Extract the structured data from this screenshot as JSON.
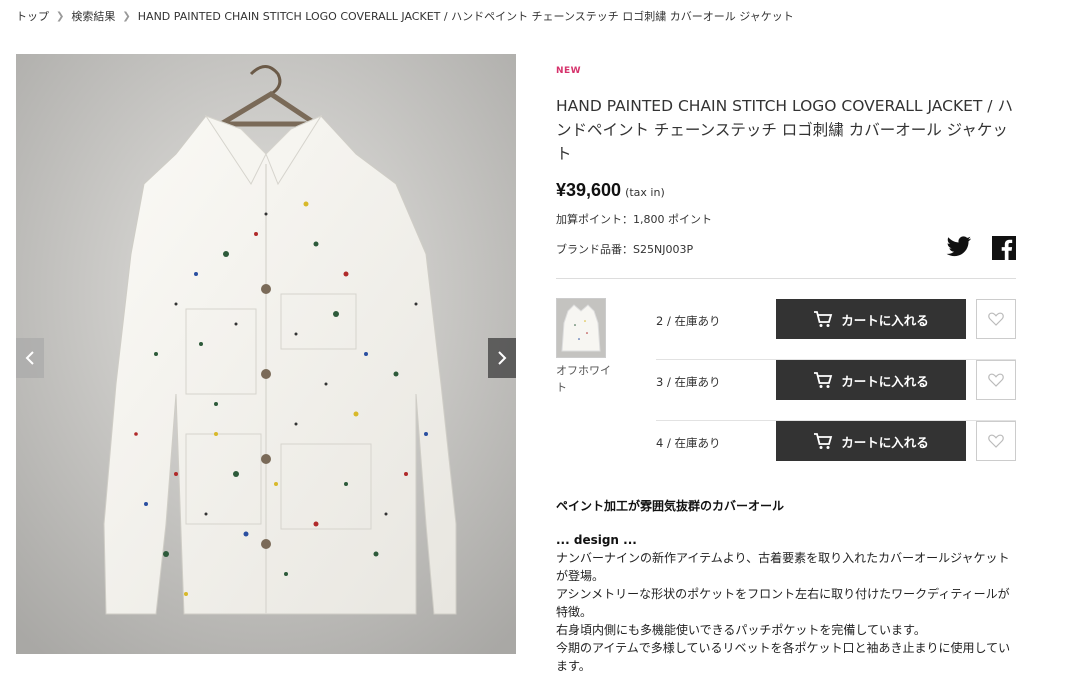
{
  "breadcrumb": {
    "items": [
      "トップ",
      "検索結果",
      "HAND PAINTED CHAIN STITCH LOGO COVERALL JACKET / ハンドペイント チェーンステッチ ロゴ刺繍 カバーオール ジャケット"
    ]
  },
  "product": {
    "badge": "NEW",
    "title": "HAND PAINTED CHAIN STITCH LOGO COVERALL JACKET / ハンドペイント チェーンステッチ ロゴ刺繍 カバーオール ジャケット",
    "price": "¥39,600",
    "tax_note": "(tax in)",
    "points": "加算ポイント：1,800 ポイント",
    "brand_code": "ブランド品番：S25NJ003P"
  },
  "share": {
    "twitter_icon": "twitter-icon",
    "facebook_icon": "facebook-icon"
  },
  "variant": {
    "color_name": "オフホワイト",
    "sizes": [
      {
        "label": "2 / 在庫あり",
        "cart_label": "カートに入れる"
      },
      {
        "label": "3 / 在庫あり",
        "cart_label": "カートに入れる"
      },
      {
        "label": "4 / 在庫あり",
        "cart_label": "カートに入れる"
      }
    ]
  },
  "description": {
    "heading": "ペイント加工が雰囲気抜群のカバーオール",
    "subheading": "... design ...",
    "paragraphs": [
      "ナンバーナインの新作アイテムより、古着要素を取り入れたカバーオールジャケットが登場。",
      "アシンメトリーな形状のポケットをフロント左右に取り付けたワークディティールが特徴。",
      "右身頃内側にも多機能使いできるパッチポケットを完備しています。",
      "今期のアイテムで多様しているリベットを各ポケット口と袖あき止まりに使用しています。"
    ]
  },
  "colors": {
    "accent": "#d6336c",
    "button": "#333333",
    "background": "#ffffff"
  }
}
